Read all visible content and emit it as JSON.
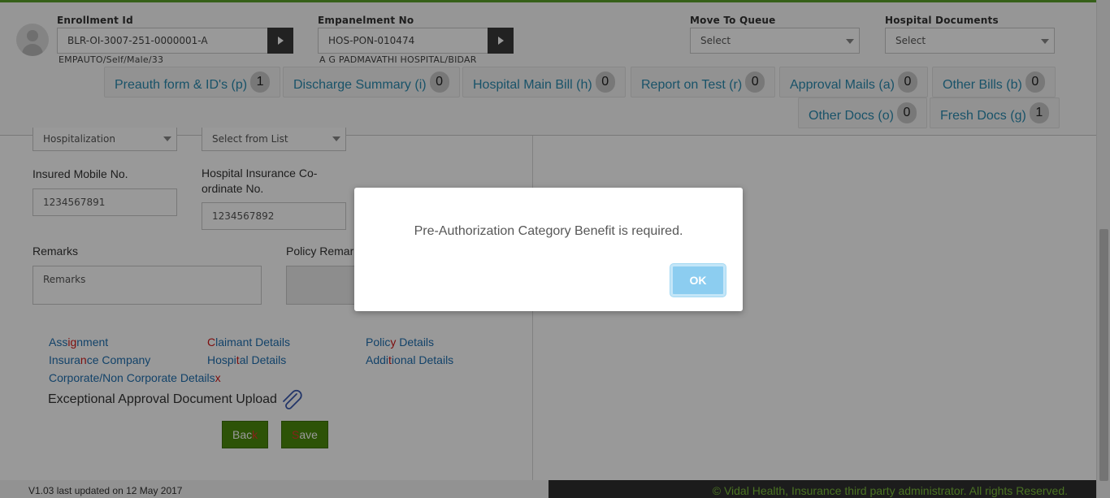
{
  "header": {
    "enrollment": {
      "label": "Enrollment Id",
      "value": "BLR-OI-3007-251-0000001-A",
      "subtext": "EMPAUTO/Self/Male/33"
    },
    "empanelment": {
      "label": "Empanelment No",
      "value": "HOS-PON-010474",
      "subtext": "A G PADMAVATHI HOSPITAL/BIDAR"
    },
    "move_to_queue": {
      "label": "Move To Queue",
      "selected": "Select"
    },
    "hospital_documents": {
      "label": "Hospital Documents",
      "selected": "Select"
    }
  },
  "doc_tabs": [
    {
      "label": "Preauth form & ID's (p)",
      "count": "1"
    },
    {
      "label": "Discharge Summary (i)",
      "count": "0"
    },
    {
      "label": "Hospital Main Bill (h)",
      "count": "0"
    },
    {
      "label": "Report on Test (r)",
      "count": "0"
    },
    {
      "label": "Approval Mails (a)",
      "count": "0"
    },
    {
      "label": "Other Bills (b)",
      "count": "0"
    },
    {
      "label": "Other Docs (o)",
      "count": "0"
    },
    {
      "label": "Fresh Docs (g)",
      "count": "1"
    }
  ],
  "form": {
    "treatment_type": "Hospitalization",
    "select_from_list": "Select from List",
    "insured_mobile": {
      "label": "Insured Mobile No.",
      "value": "1234567891"
    },
    "hospital_coordinate": {
      "label": "Hospital Insurance Co-ordinate No.",
      "value": "1234567892"
    },
    "remarks": {
      "label": "Remarks",
      "placeholder": "Remarks"
    },
    "policy_remarks": {
      "label": "Policy Remarks"
    },
    "links": {
      "assignment": [
        "Ass",
        "i",
        "g",
        "nment"
      ],
      "claimant": [
        "",
        "C",
        "laimant Details"
      ],
      "policy": [
        "Polic",
        "y",
        " Details"
      ],
      "insurance": [
        "Insura",
        "n",
        "ce Company"
      ],
      "hospital": [
        "Hospi",
        "t",
        "al Details"
      ],
      "additional": [
        "Addi",
        "t",
        "ional Details"
      ],
      "corporate": [
        "Corporate/Non Corporate Details",
        "x"
      ]
    },
    "upload_label": "Exceptional Approval Document Upload",
    "back": [
      "Bac",
      "k"
    ],
    "save": [
      "",
      "S",
      "ave"
    ]
  },
  "footer": {
    "version": "V1.03 last updated on 12 May 2017",
    "copyright": "© Vidal Health, Insurance third party administrator. All rights Reserved."
  },
  "dialog": {
    "message": "Pre-Authorization Category Benefit is required.",
    "ok_label": "OK"
  },
  "colors": {
    "brand_green": "#4c8a0d",
    "link_blue": "#1f6fb0",
    "dialog_button": "#8ccdf0"
  }
}
